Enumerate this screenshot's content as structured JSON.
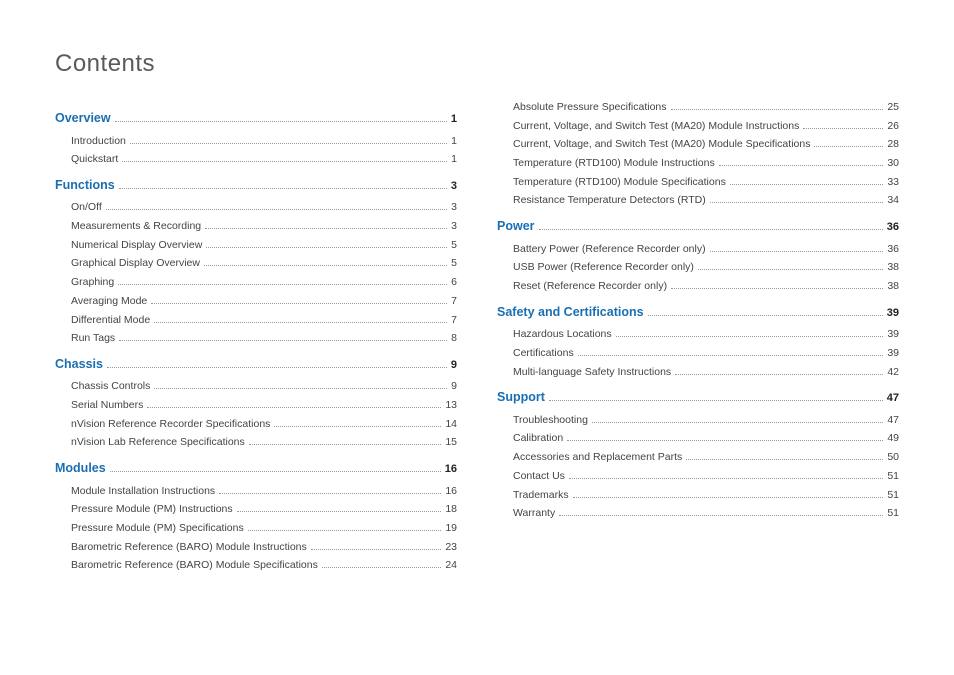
{
  "title": "Contents",
  "left_column": [
    {
      "type": "section",
      "label": "Overview",
      "page": "1"
    },
    {
      "type": "sub",
      "label": "Introduction",
      "page": "1"
    },
    {
      "type": "sub",
      "label": "Quickstart",
      "page": "1"
    },
    {
      "type": "section",
      "label": "Functions",
      "page": "3"
    },
    {
      "type": "sub",
      "label": "On/Off",
      "page": "3"
    },
    {
      "type": "sub",
      "label": "Measurements & Recording",
      "page": "3"
    },
    {
      "type": "sub",
      "label": "Numerical Display Overview",
      "page": "5"
    },
    {
      "type": "sub",
      "label": "Graphical Display Overview",
      "page": "5"
    },
    {
      "type": "sub",
      "label": "Graphing",
      "page": "6"
    },
    {
      "type": "sub",
      "label": "Averaging Mode",
      "page": "7"
    },
    {
      "type": "sub",
      "label": "Differential Mode",
      "page": "7"
    },
    {
      "type": "sub",
      "label": "Run Tags",
      "page": "8"
    },
    {
      "type": "section",
      "label": "Chassis",
      "page": "9"
    },
    {
      "type": "sub",
      "label": "Chassis Controls",
      "page": "9"
    },
    {
      "type": "sub",
      "label": "Serial Numbers",
      "page": "13"
    },
    {
      "type": "sub",
      "label": "nVision Reference Recorder Specifications",
      "page": "14"
    },
    {
      "type": "sub",
      "label": "nVision Lab Reference Specifications",
      "page": "15"
    },
    {
      "type": "section",
      "label": "Modules",
      "page": "16"
    },
    {
      "type": "sub",
      "label": "Module Installation Instructions",
      "page": "16"
    },
    {
      "type": "sub",
      "label": "Pressure Module (PM) Instructions",
      "page": "18"
    },
    {
      "type": "sub",
      "label": "Pressure Module (PM) Specifications",
      "page": "19"
    },
    {
      "type": "sub",
      "label": "Barometric Reference (BARO) Module Instructions",
      "page": "23"
    },
    {
      "type": "sub",
      "label": "Barometric Reference (BARO) Module Specifications",
      "page": "24"
    }
  ],
  "right_column": [
    {
      "type": "sub",
      "label": "Absolute Pressure Specifications",
      "page": "25"
    },
    {
      "type": "sub",
      "label": "Current, Voltage, and Switch Test (MA20) Module Instructions",
      "page": "26"
    },
    {
      "type": "sub",
      "label": "Current, Voltage, and Switch Test (MA20) Module Specifications",
      "page": "28"
    },
    {
      "type": "sub",
      "label": "Temperature (RTD100) Module Instructions",
      "page": "30"
    },
    {
      "type": "sub",
      "label": "Temperature (RTD100) Module Specifications",
      "page": "33"
    },
    {
      "type": "sub",
      "label": "Resistance Temperature Detectors (RTD)",
      "page": "34"
    },
    {
      "type": "section",
      "label": "Power",
      "page": "36"
    },
    {
      "type": "sub",
      "label": "Battery Power (Reference Recorder only)",
      "page": "36"
    },
    {
      "type": "sub",
      "label": "USB Power (Reference Recorder only)",
      "page": "38"
    },
    {
      "type": "sub",
      "label": "Reset (Reference Recorder only)",
      "page": "38"
    },
    {
      "type": "section",
      "label": "Safety and Certifications",
      "page": "39"
    },
    {
      "type": "sub",
      "label": "Hazardous Locations",
      "page": "39"
    },
    {
      "type": "sub",
      "label": "Certifications",
      "page": "39"
    },
    {
      "type": "sub",
      "label": "Multi-language Safety Instructions",
      "page": "42"
    },
    {
      "type": "section",
      "label": "Support",
      "page": "47"
    },
    {
      "type": "sub",
      "label": "Troubleshooting",
      "page": "47"
    },
    {
      "type": "sub",
      "label": "Calibration",
      "page": "49"
    },
    {
      "type": "sub",
      "label": "Accessories and Replacement Parts",
      "page": "50"
    },
    {
      "type": "sub",
      "label": "Contact Us",
      "page": "51"
    },
    {
      "type": "sub",
      "label": "Trademarks",
      "page": "51"
    },
    {
      "type": "sub",
      "label": "Warranty",
      "page": "51"
    }
  ]
}
